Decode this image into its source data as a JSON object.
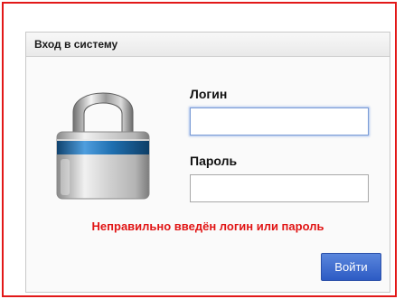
{
  "dialog": {
    "title": "Вход в систему"
  },
  "form": {
    "login_label": "Логин",
    "login_value": "",
    "password_label": "Пароль",
    "password_value": "",
    "error_message": "Неправильно введён логин или пароль",
    "submit_label": "Войти"
  },
  "colors": {
    "frame_border": "#e21818",
    "error_text": "#e11515",
    "button": "#3a6ad0",
    "lock_band": "#1f6fb0"
  },
  "icons": {
    "lock": "padlock-icon"
  }
}
